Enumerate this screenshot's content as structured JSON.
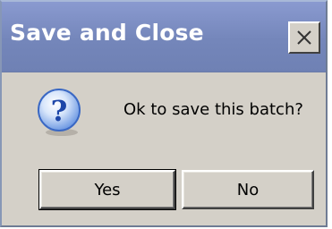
{
  "window": {
    "title": "Save and Close",
    "close_icon": "close-icon"
  },
  "body": {
    "icon": "question-icon",
    "message": "Ok to save this batch?"
  },
  "buttons": {
    "yes_label": "Yes",
    "no_label": "No"
  },
  "colors": {
    "titlebar": "#7486ba",
    "dialog_background": "#d4d0c8",
    "title_text": "#ffffff",
    "icon_blue": "#2f5fc0"
  }
}
